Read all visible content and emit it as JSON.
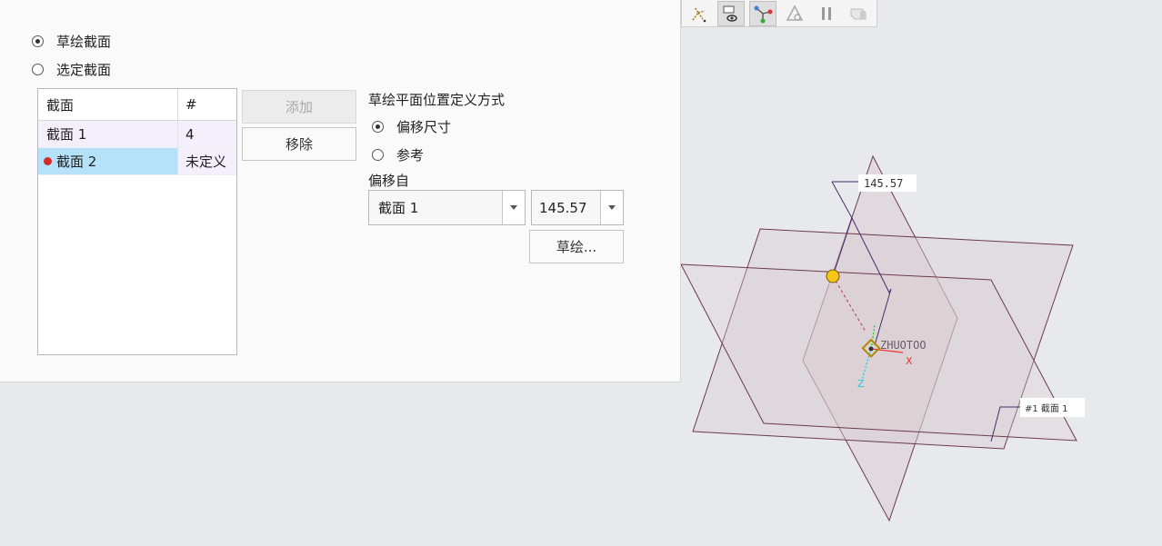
{
  "section_mode": {
    "option_sketched": "草绘截面",
    "option_selected": "选定截面",
    "sketched_checked": true
  },
  "section_list": {
    "headers": [
      "截面",
      "#"
    ],
    "rows": [
      {
        "name": "截面 1",
        "num": "4"
      },
      {
        "name": "截面 2",
        "num": "未定义",
        "active": true
      }
    ]
  },
  "buttons": {
    "add": "添加",
    "remove": "移除",
    "sketch": "草绘..."
  },
  "placement": {
    "title": "草绘平面位置定义方式",
    "option_offset": "偏移尺寸",
    "option_reference": "参考",
    "offset_checked": true,
    "offset_from_label": "偏移自",
    "offset_from_value": "截面 1",
    "offset_value": "145.57"
  },
  "viewport": {
    "dim_label": "145.57",
    "section_tag": "#1 截面 1",
    "csys_name": "ZHUOTOO",
    "axis_x": "X",
    "axis_z": "Z"
  },
  "colors": {
    "selection_blue": "#b5e2f8",
    "marker_red": "#d42a2a",
    "handle_yellow": "#f5c518",
    "plane_fill": "#d9cdd2",
    "plane_edge": "#6b3a4d"
  }
}
